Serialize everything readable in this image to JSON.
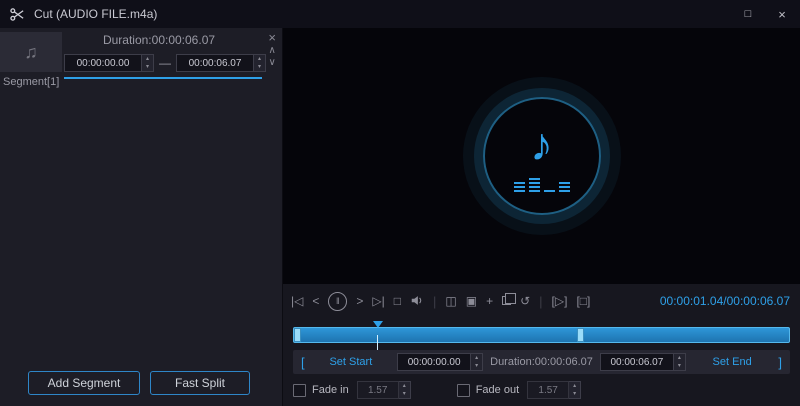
{
  "titlebar": {
    "title": "Cut (AUDIO FILE.m4a)"
  },
  "segment_panel": {
    "duration_label": "Duration:00:00:06.07",
    "start_value": "00:00:00.00",
    "range_separator": "—",
    "end_value": "00:00:06.07",
    "segment_label": "Segment[1]",
    "add_segment_label": "Add Segment",
    "fast_split_label": "Fast Split"
  },
  "transport": {
    "time_display": "00:00:01.04/00:00:06.07"
  },
  "timeline": {
    "playhead_style": "left:17%"
  },
  "trim_bar": {
    "bracket_left": "[",
    "set_start_label": "Set Start",
    "start_value": "00:00:00.00",
    "duration_label": "Duration:00:00:06.07",
    "end_value": "00:00:06.07",
    "set_end_label": "Set End",
    "bracket_right": "]"
  },
  "fade": {
    "fade_in_label": "Fade in",
    "fade_in_value": "1.57",
    "fade_out_label": "Fade out",
    "fade_out_value": "1.57"
  },
  "icons": {
    "maximize": "□",
    "close": "×",
    "segment_close": "×",
    "chevron_up": "∧",
    "chevron_down": "∨",
    "thumb_note": "♫",
    "preview_note": "♪",
    "spinner_up": "▴",
    "spinner_down": "▾",
    "skip_start": "|◁",
    "step_back": "<",
    "pause": "‖",
    "step_forward": ">",
    "skip_end": "▷|",
    "stop": "□",
    "split": "◫",
    "frame": "▣",
    "add": "+",
    "reset": "↺",
    "play_segment": "[▷]",
    "stop_segment": "[□]",
    "separator": "|"
  },
  "colors": {
    "accent": "#2ea0e8"
  }
}
